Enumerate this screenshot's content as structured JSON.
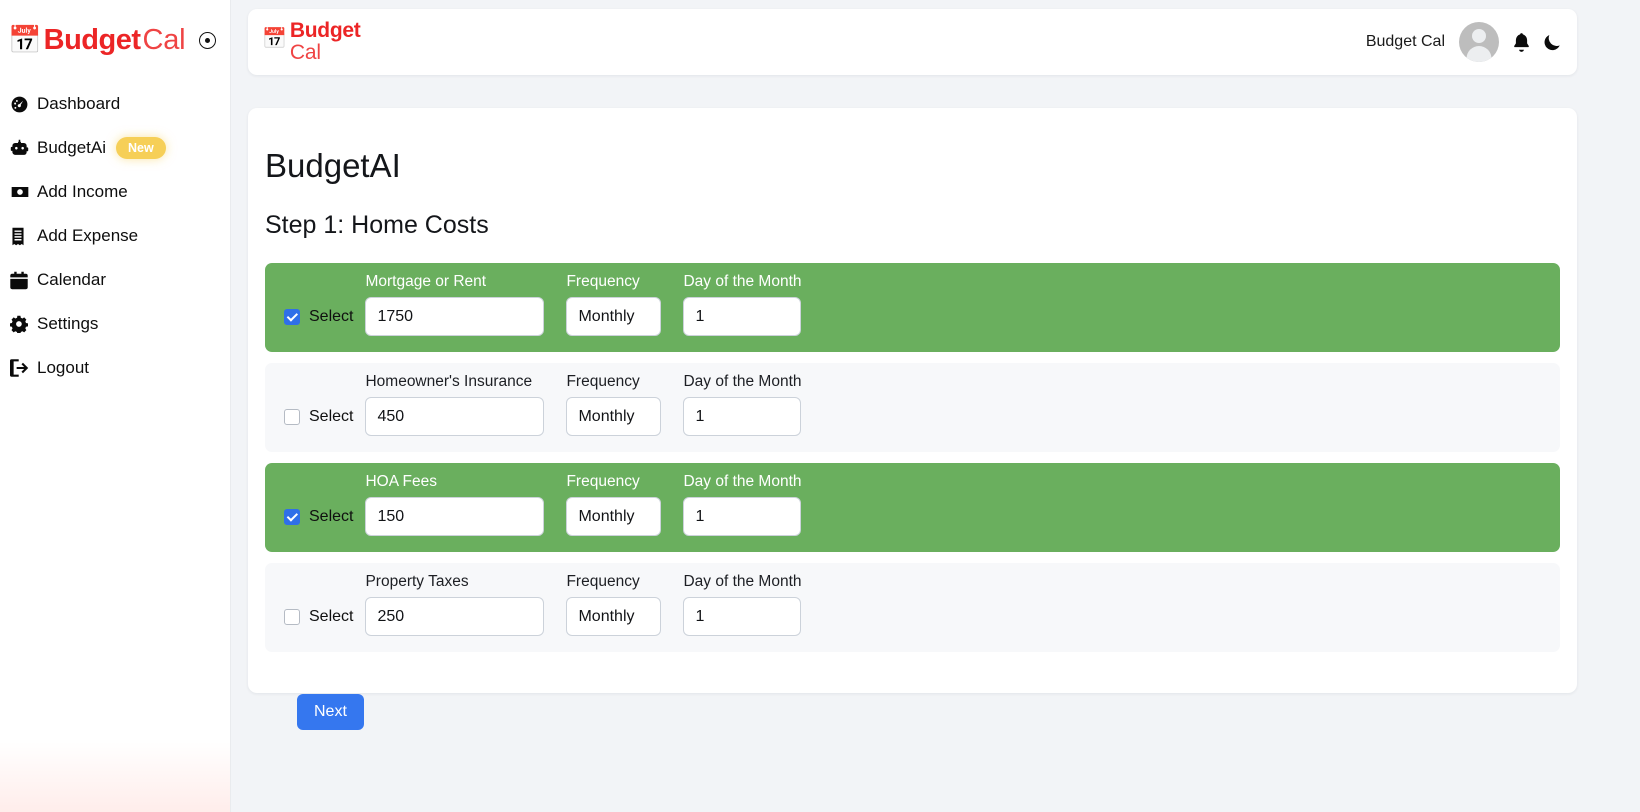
{
  "sidebar": {
    "brand": {
      "emoji": "📅",
      "name_bold": "Budget",
      "name_light": "Cal",
      "collapse_icon": "circle-dot-icon"
    },
    "items": [
      {
        "label": "Dashboard",
        "icon": "gauge-icon",
        "badge": null
      },
      {
        "label": "BudgetAi",
        "icon": "robot-icon",
        "badge": "New"
      },
      {
        "label": "Add Income",
        "icon": "money-bill-icon",
        "badge": null
      },
      {
        "label": "Add Expense",
        "icon": "receipt-icon",
        "badge": null
      },
      {
        "label": "Calendar",
        "icon": "calendar-icon",
        "badge": null
      },
      {
        "label": "Settings",
        "icon": "gear-icon",
        "badge": null
      },
      {
        "label": "Logout",
        "icon": "sign-out-icon",
        "badge": null
      }
    ]
  },
  "topbar": {
    "logo_emoji": "📅",
    "logo_bold": "Budget",
    "logo_light": "Cal",
    "user_name": "Budget Cal",
    "avatar": "user-avatar",
    "notifications_icon": "bell-icon",
    "theme_icon": "moon-icon"
  },
  "main": {
    "title": "BudgetAI",
    "step_title": "Step 1: Home Costs",
    "select_label": "Select",
    "frequency_label": "Frequency",
    "day_label": "Day of the Month",
    "next_label": "Next",
    "rows": [
      {
        "name": "Mortgage or Rent",
        "amount": "1750",
        "frequency": "Monthly",
        "day": "1",
        "selected": true
      },
      {
        "name": "Homeowner's Insurance",
        "amount": "450",
        "frequency": "Monthly",
        "day": "1",
        "selected": false
      },
      {
        "name": "HOA Fees",
        "amount": "150",
        "frequency": "Monthly",
        "day": "1",
        "selected": true
      },
      {
        "name": "Property Taxes",
        "amount": "250",
        "frequency": "Monthly",
        "day": "1",
        "selected": false
      }
    ]
  },
  "colors": {
    "brand_red": "#ec2526",
    "selected_green": "#6aaf5e",
    "accent_blue": "#3577ef",
    "badge_yellow": "#f6cf57",
    "page_bg": "#f2f4f7"
  }
}
